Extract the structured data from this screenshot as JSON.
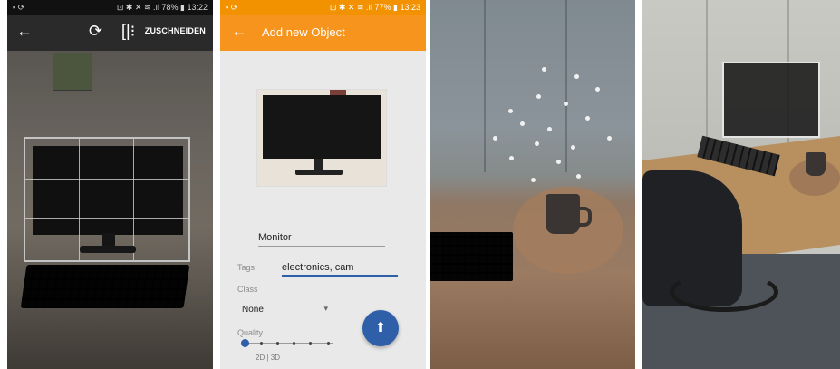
{
  "crop_screen": {
    "status": {
      "left": "▪ ⟳",
      "right": "⊡ ✱ ✕ ≋ .ıl 78% ▮ 13:22"
    },
    "toolbar": {
      "back": "←",
      "rotate": "⟳",
      "flip": "[|⁝",
      "crop_label": "ZUSCHNEIDEN"
    }
  },
  "form_screen": {
    "status": {
      "left": "▪ ⟳",
      "right": "⊡ ✱ ✕ ≋ .ıl 77% ▮ 13:23"
    },
    "appbar": {
      "back": "←",
      "title": "Add new Object"
    },
    "name_value": "Monitor",
    "tags_label": "Tags",
    "tags_value": "electronics, cam",
    "class_label": "Class",
    "class_value": "None",
    "class_arrow": "▾",
    "quality_label": "Quality",
    "quality_caption": "2D | 3D",
    "quality_level": 0,
    "fab_icon": "⬆",
    "colors": {
      "accent": "#f7941d",
      "primary": "#2f5fa8"
    }
  },
  "ar_scan_view": {},
  "scene_view": {}
}
